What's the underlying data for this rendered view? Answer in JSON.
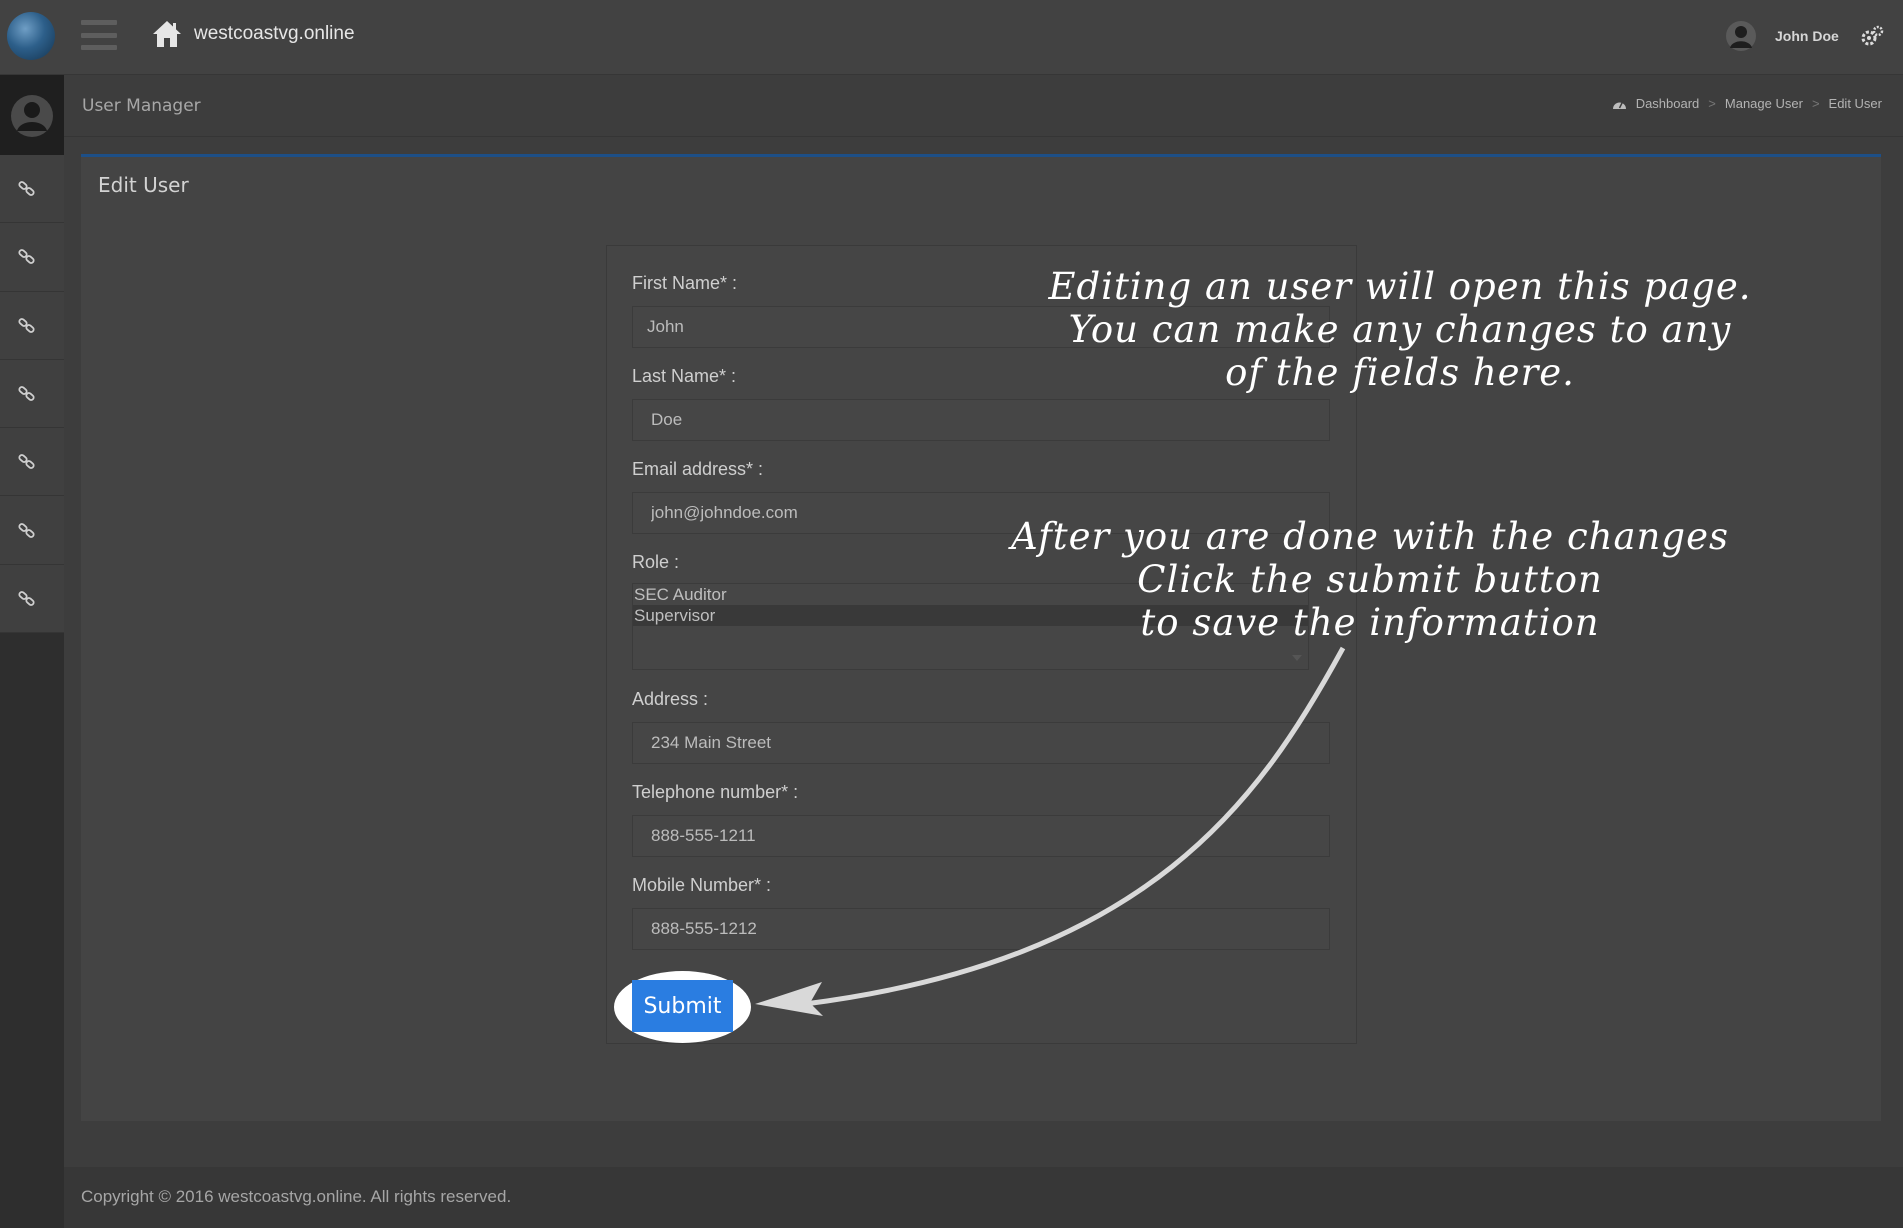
{
  "topbar": {
    "site_name": "westcoastvg.online",
    "user_name": "John Doe",
    "icons": [
      "globe-logo-icon",
      "hamburger-menu-icon",
      "home-icon",
      "user-avatar-icon",
      "settings-icon"
    ]
  },
  "sidebar": {
    "items": [
      {
        "icon": "link-icon"
      },
      {
        "icon": "link-icon"
      },
      {
        "icon": "link-icon"
      },
      {
        "icon": "link-icon"
      },
      {
        "icon": "link-icon"
      },
      {
        "icon": "link-icon"
      },
      {
        "icon": "link-icon"
      }
    ]
  },
  "header": {
    "title": "User Manager",
    "breadcrumb": {
      "dashboard": "Dashboard",
      "separator": ">",
      "manage_user": "Manage User",
      "current": "Edit User"
    }
  },
  "box": {
    "title": "Edit User"
  },
  "form": {
    "first_name": {
      "label": "First Name* :",
      "value": "John"
    },
    "last_name": {
      "label": "Last Name* :",
      "value": "Doe"
    },
    "email": {
      "label": "Email address* :",
      "value": "john@johndoe.com"
    },
    "role": {
      "label": "Role :",
      "options": [
        "SEC Auditor",
        "Supervisor"
      ],
      "selected": "Supervisor"
    },
    "address": {
      "label": "Address :",
      "value": "234 Main Street"
    },
    "telephone": {
      "label": "Telephone number* :",
      "value": "888-555-1211"
    },
    "mobile": {
      "label": "Mobile Number* :",
      "value": "888-555-1212"
    },
    "submit_label": "Submit"
  },
  "annotations": {
    "note1": {
      "line1": "Editing an user will open this page.",
      "line2": "You can make any  changes to any",
      "line3": "of the fields here."
    },
    "note2": {
      "line1": "After you are done with the changes",
      "line2": "Click the submit button",
      "line3": "to save the information"
    }
  },
  "footer": {
    "copyright": "Copyright © 2016 westcoastvg.online. All rights reserved."
  },
  "colors": {
    "accent_blue": "#2a7de1",
    "box_border": "#1d4f87",
    "background": "#3d3d3d"
  }
}
